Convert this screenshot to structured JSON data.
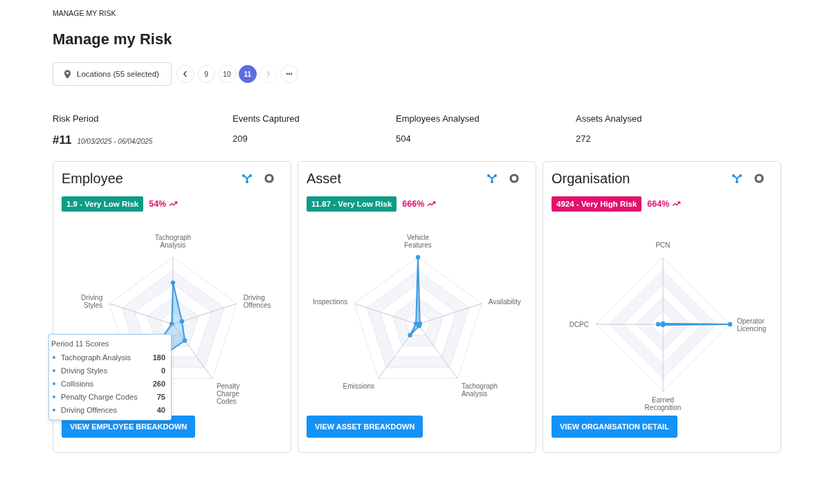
{
  "breadcrumb": "MANAGE MY RISK",
  "title": "Manage my Risk",
  "location_filter": {
    "label": "Locations (55 selected)"
  },
  "pagination": {
    "prev": {
      "disabled": false
    },
    "next": {
      "disabled": true
    },
    "more": "•••",
    "pages": [
      {
        "label": "9",
        "selected": false
      },
      {
        "label": "10",
        "selected": false
      },
      {
        "label": "11",
        "selected": true
      }
    ]
  },
  "stats": [
    {
      "kind": "period",
      "label": "Risk Period",
      "value": "#11",
      "range": "10/03/2025 - 06/04/2025"
    },
    {
      "kind": "plain",
      "label": "Events Captured",
      "value": "209"
    },
    {
      "kind": "plain",
      "label": "Employees Analysed",
      "value": "504"
    },
    {
      "kind": "plain",
      "label": "Assets Analysed",
      "value": "272"
    }
  ],
  "cards": [
    {
      "title": "Employee",
      "badge": {
        "text": "1.9 - Very Low Risk",
        "color": "#0e9c86"
      },
      "trend": "54%",
      "button": "VIEW EMPLOYEE BREAKDOWN",
      "axes": [
        {
          "label": "Tachograph Analysis"
        },
        {
          "label": "Driving Styles"
        },
        {
          "covered": true
        },
        {
          "label": "Penalty Charge Codes"
        },
        {
          "label": "Driving Offences"
        }
      ],
      "tooltip": {
        "title": "Period 11 Scores",
        "rows": [
          {
            "label": "Tachograph Analysis",
            "value": "180"
          },
          {
            "label": "Driving Styles",
            "value": "0"
          },
          {
            "label": "Collisions",
            "value": "260"
          },
          {
            "label": "Penalty Charge Codes",
            "value": "75"
          },
          {
            "label": "Driving Offences",
            "value": "40"
          }
        ]
      }
    },
    {
      "title": "Asset",
      "badge": {
        "text": "11.87 - Very Low Risk",
        "color": "#0e9c86"
      },
      "trend": "666%",
      "button": "VIEW ASSET BREAKDOWN",
      "axes": [
        {
          "label": "Vehicle Features"
        },
        {
          "label": "Inspections"
        },
        {
          "label": "Emissions"
        },
        {
          "label": "Tachograph Analysis"
        },
        {
          "label": "Availability"
        }
      ]
    },
    {
      "title": "Organisation",
      "badge": {
        "text": "4924 - Very High Risk",
        "color": "#e3126e"
      },
      "trend": "664%",
      "button": "VIEW ORGANISATION DETAIL",
      "axes": [
        {
          "label": "PCN"
        },
        {
          "label": "DCPC"
        },
        {
          "label": "Earned Recognition"
        },
        {
          "label": "Operator Licencing"
        }
      ]
    }
  ]
}
